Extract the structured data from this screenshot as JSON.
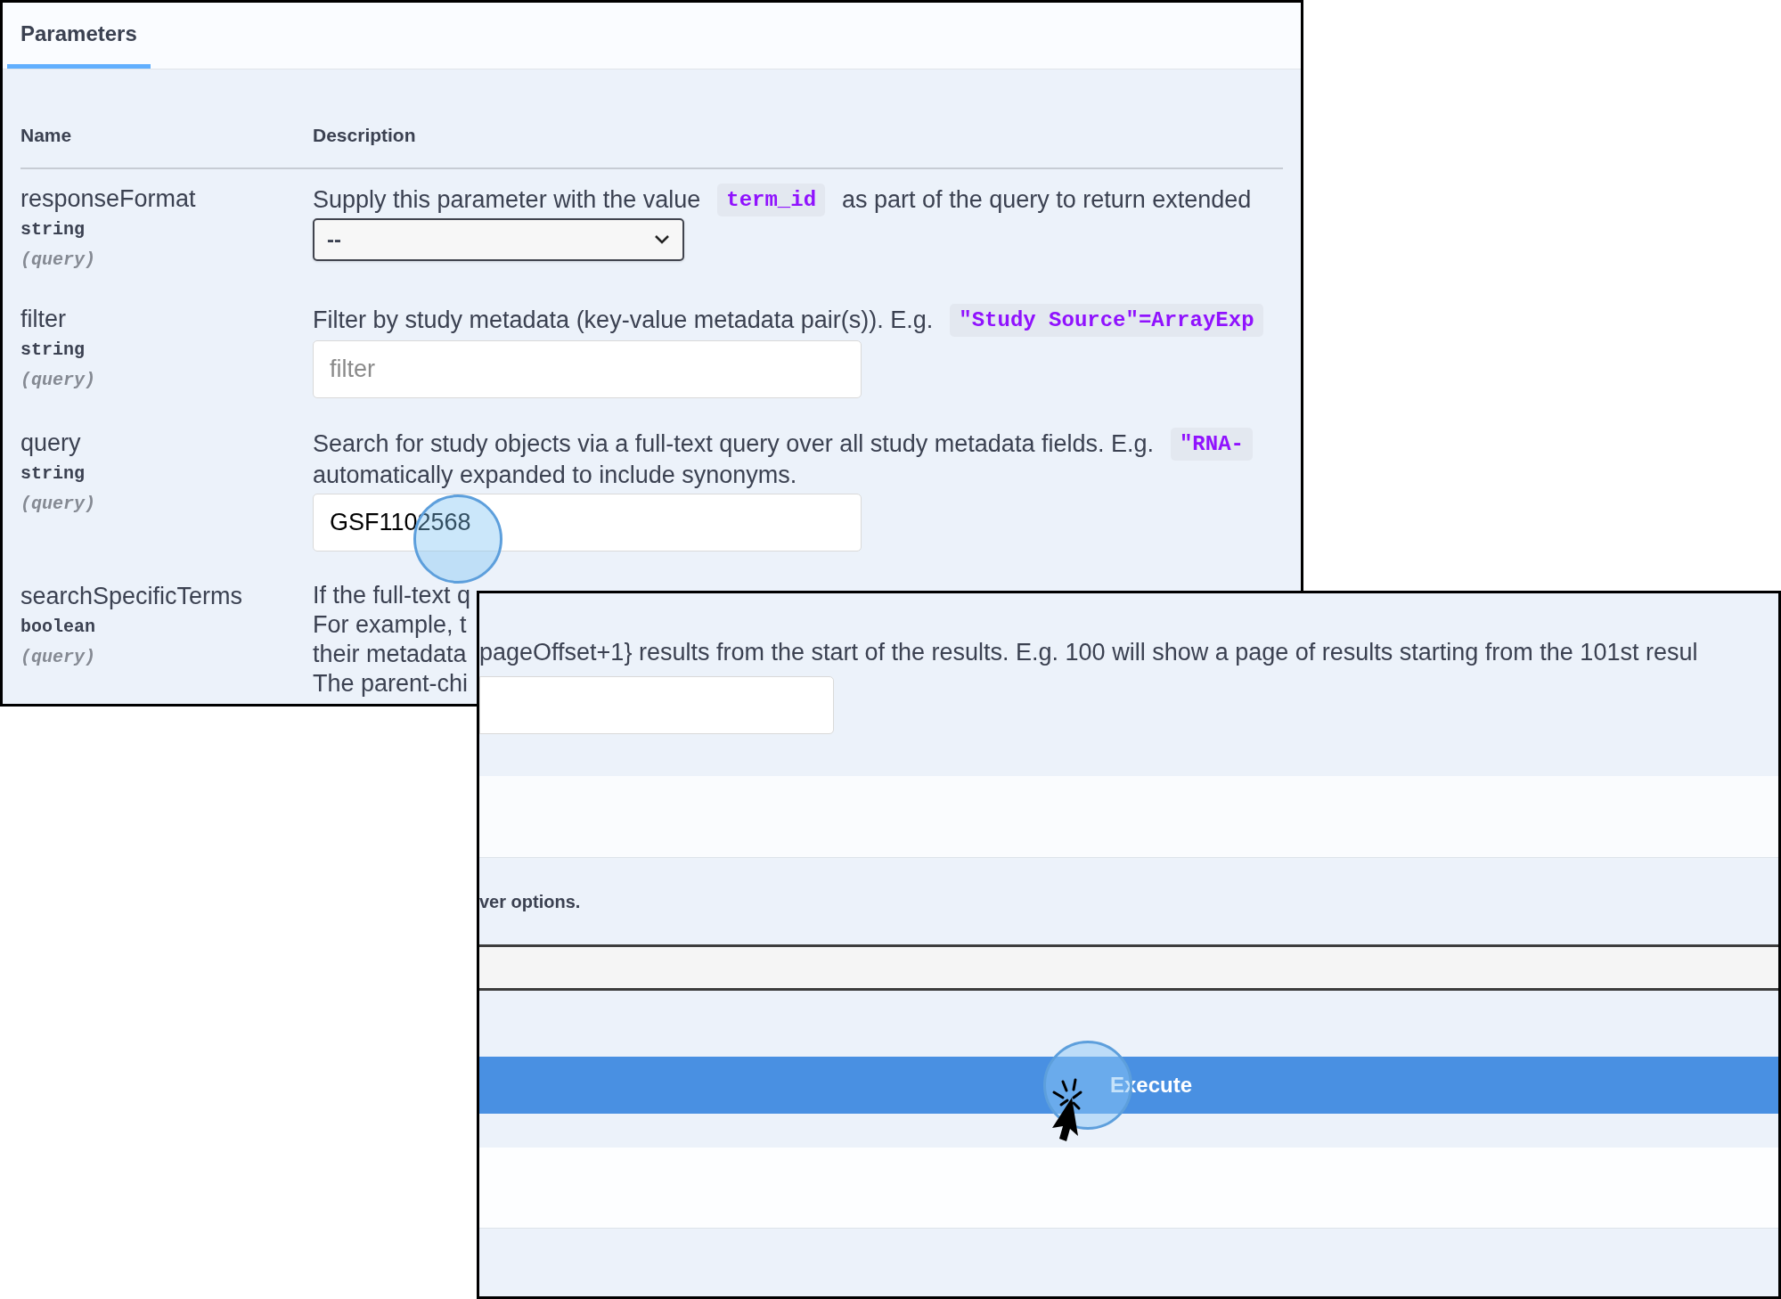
{
  "top_panel": {
    "tabs": [
      {
        "label": "Parameters",
        "selected": true
      }
    ],
    "columns": [
      "Name",
      "Description"
    ],
    "params": [
      {
        "name": "responseFormat",
        "type": "string",
        "location": "(query)",
        "description": [
          [
            {
              "kind": "text",
              "text": "Supply this parameter with the value"
            },
            {
              "kind": "code",
              "text": "term_id"
            },
            {
              "kind": "text",
              "text": "as part of the query to return extended"
            }
          ]
        ],
        "control": {
          "kind": "select",
          "value": "--"
        }
      },
      {
        "name": "filter",
        "type": "string",
        "location": "(query)",
        "description": [
          [
            {
              "kind": "text",
              "text": "Filter by study metadata (key-value metadata pair(s)). E.g."
            },
            {
              "kind": "code",
              "text": "\"Study Source\"=ArrayExp"
            }
          ]
        ],
        "control": {
          "kind": "input",
          "placeholder": "filter"
        }
      },
      {
        "name": "query",
        "type": "string",
        "location": "(query)",
        "description": [
          [
            {
              "kind": "text",
              "text": "Search for study objects via a full-text query over all study metadata fields. E.g."
            },
            {
              "kind": "code",
              "text": "\"RNA-"
            }
          ],
          [
            {
              "kind": "text",
              "text": "automatically expanded to include synonyms."
            }
          ]
        ],
        "control": {
          "kind": "input",
          "value": "GSF1102568"
        }
      },
      {
        "name": "searchSpecificTerms",
        "type": "boolean",
        "location": "(query)",
        "description": [
          [
            {
              "kind": "text",
              "text": "If the full-text q"
            }
          ],
          [
            {
              "kind": "text",
              "text": "For example, t"
            }
          ],
          [
            {
              "kind": "text",
              "text": "their metadata"
            }
          ],
          [
            {
              "kind": "text",
              "text": "The parent-chi"
            }
          ]
        ]
      }
    ]
  },
  "bottom_panel": {
    "description": "pageOffset+1} results from the start of the results. E.g. 100 will show a page of results starting from the 101st resul",
    "note": "ver options.",
    "execute": {
      "label": "Execute"
    }
  }
}
